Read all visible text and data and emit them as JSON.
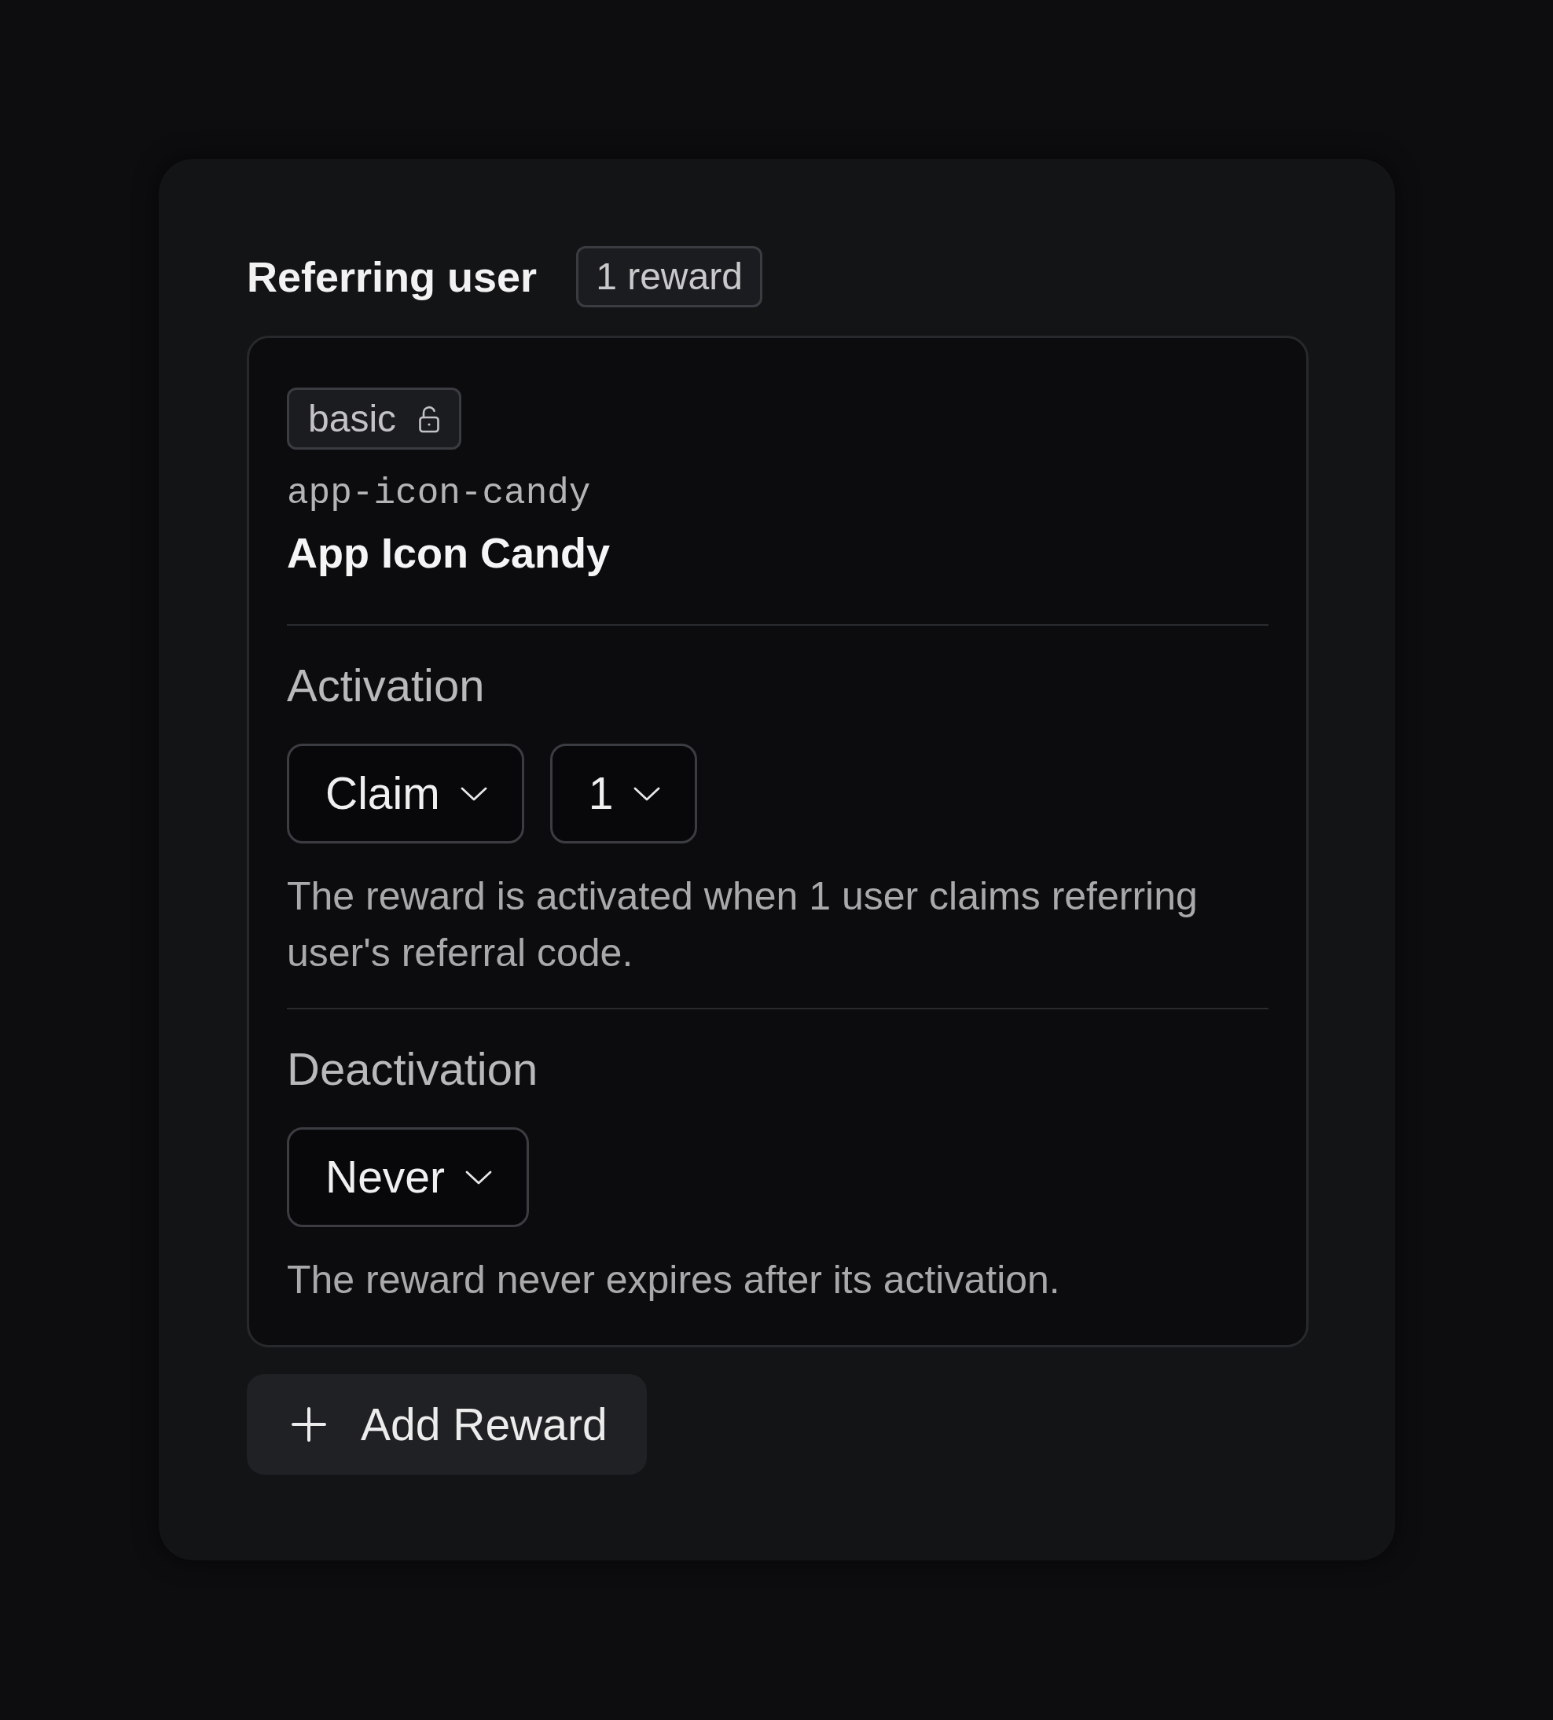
{
  "section": {
    "title": "Referring user",
    "count_badge": "1 reward"
  },
  "rewards": [
    {
      "tier": "basic",
      "locked": false,
      "slug": "app-icon-candy",
      "name": "App Icon Candy",
      "rules": [
        {
          "label": "Activation",
          "selects": [
            "Claim",
            "1"
          ],
          "description": "The reward is activated when 1 user claims referring user's referral code."
        },
        {
          "label": "Deactivation",
          "selects": [
            "Never"
          ],
          "description": "The reward never expires after its activation."
        }
      ]
    }
  ],
  "add_button": {
    "label": "Add Reward"
  }
}
